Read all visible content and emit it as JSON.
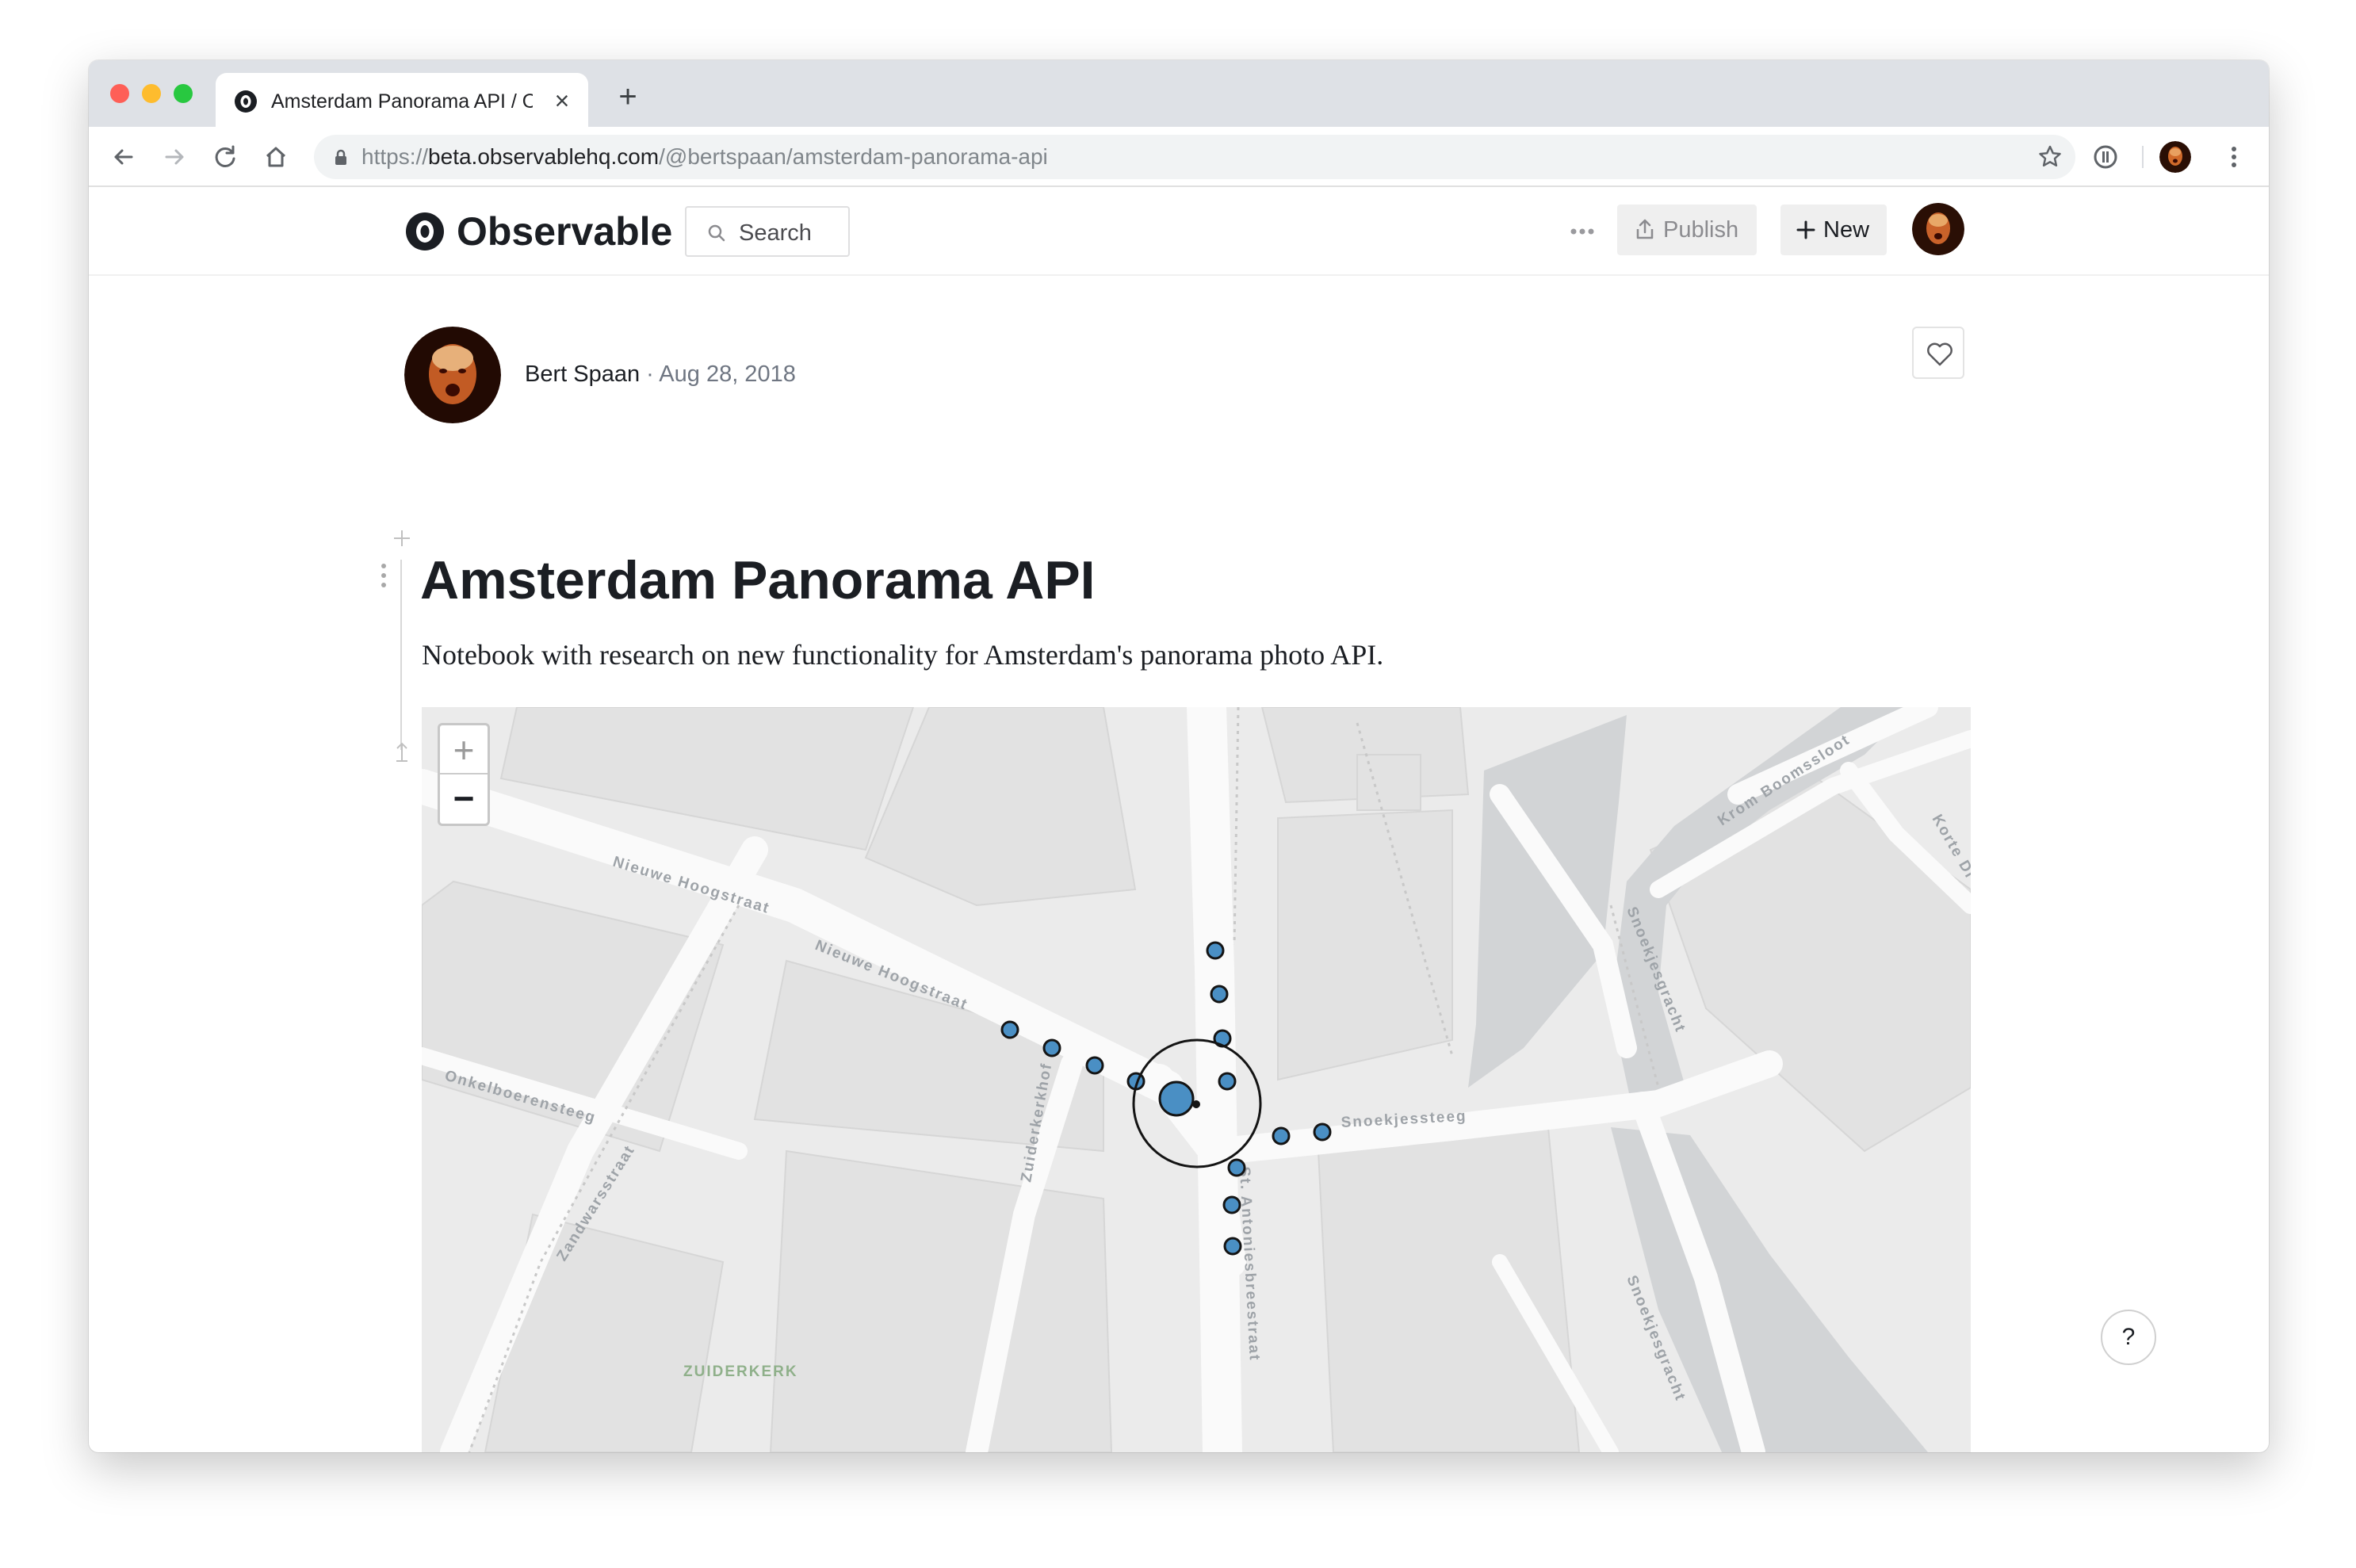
{
  "browser": {
    "tab_title": "Amsterdam Panorama API / Ob",
    "tab_close": "×",
    "new_tab": "+",
    "url_scheme": "https://",
    "url_host": "beta.observablehq.com",
    "url_path": "/@bertspaan/amsterdam-panorama-api"
  },
  "header": {
    "brand": "Observable",
    "search_label": "Search",
    "publish_label": "Publish",
    "new_label": "New"
  },
  "author": {
    "name": "Bert Spaan",
    "separator": " · ",
    "date": "Aug 28, 2018"
  },
  "notebook": {
    "title": "Amsterdam Panorama API",
    "description": "Notebook with research on new functionality for Amsterdam's panorama photo API."
  },
  "map": {
    "zoom_in": "+",
    "zoom_out": "−",
    "street_labels": {
      "nieuwe_hoogstraat_1": "Nieuwe Hoogstraat",
      "nieuwe_hoogstraat_2": "Nieuwe Hoogstraat",
      "krom_boomssloot": "Krom Boomssloot",
      "korte_di": "Korte Di",
      "snoekjesgracht_1": "Snoekjesgracht",
      "snoekjesgracht_2": "Snoekjesgracht",
      "onkelboerensteeg": "Onkelboerensteeg",
      "zandwarsstraat": "Zandwarsstraat",
      "zuiderkerkhof": "Zuiderkerkhof",
      "snoekjessteeg": "Snoekjessteeg",
      "st_antoniesbreestraat": "St. Antoniesbreestraat",
      "zuiderkerk": "ZUIDERKERK"
    },
    "colors": {
      "marker_fill": "#4a8fc4",
      "water": "#d2d4d6",
      "road": "#fafafa"
    }
  },
  "help_label": "?"
}
